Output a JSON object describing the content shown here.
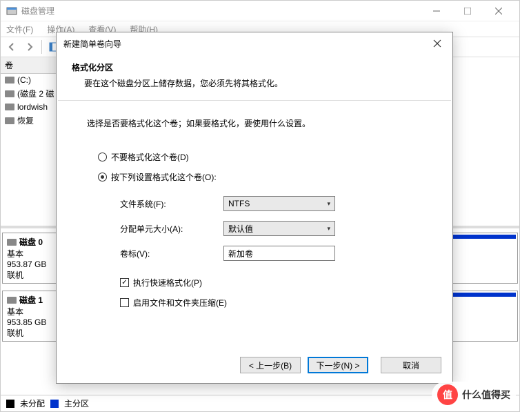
{
  "app": {
    "title": "磁盘管理",
    "menu": [
      "文件(F)",
      "操作(A)",
      "查看(V)",
      "帮助(H)"
    ]
  },
  "side": {
    "header": "卷",
    "items": [
      "(C:)",
      "(磁盘 2 磁",
      "lordwish",
      "恢复"
    ]
  },
  "disks": [
    {
      "name": "磁盘 0",
      "type": "基本",
      "size": "953.87 GB",
      "status": "联机"
    },
    {
      "name": "磁盘 1",
      "type": "基本",
      "size": "953.85 GB",
      "status": "联机"
    }
  ],
  "legend": {
    "unalloc": "未分配",
    "primary": "主分区"
  },
  "wizard": {
    "title": "新建简单卷向导",
    "heading": "格式化分区",
    "subheading": "要在这个磁盘分区上储存数据，您必须先将其格式化。",
    "intro": "选择是否要格式化这个卷；如果要格式化，要使用什么设置。",
    "radio_no_format": "不要格式化这个卷(D)",
    "radio_format": "按下列设置格式化这个卷(O):",
    "lbl_fs": "文件系统(F):",
    "val_fs": "NTFS",
    "lbl_alloc": "分配单元大小(A):",
    "val_alloc": "默认值",
    "lbl_label": "卷标(V):",
    "val_label": "新加卷",
    "chk_quick": "执行快速格式化(P)",
    "chk_compress": "启用文件和文件夹压缩(E)",
    "btn_back": "< 上一步(B)",
    "btn_next": "下一步(N) >",
    "btn_cancel": "取消"
  },
  "watermark": {
    "badge": "值",
    "text": "什么值得买"
  }
}
